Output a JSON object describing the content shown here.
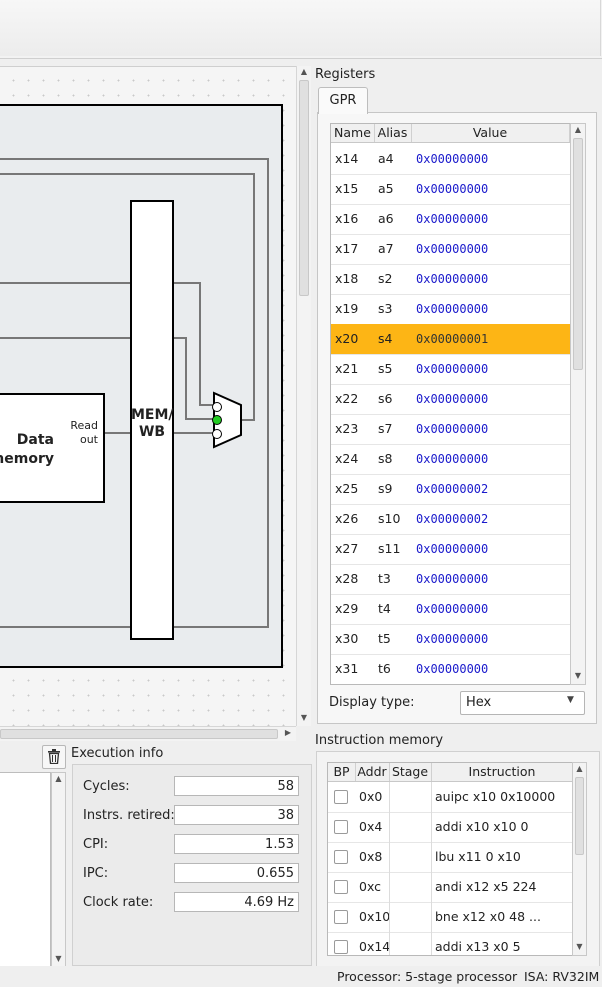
{
  "registers_panel": {
    "title": "Registers",
    "tab": "GPR",
    "columns": [
      "Name",
      "Alias",
      "Value"
    ],
    "rows": [
      {
        "name": "x14",
        "alias": "a4",
        "value": "0x00000000"
      },
      {
        "name": "x15",
        "alias": "a5",
        "value": "0x00000000"
      },
      {
        "name": "x16",
        "alias": "a6",
        "value": "0x00000000"
      },
      {
        "name": "x17",
        "alias": "a7",
        "value": "0x00000000"
      },
      {
        "name": "x18",
        "alias": "s2",
        "value": "0x00000000"
      },
      {
        "name": "x19",
        "alias": "s3",
        "value": "0x00000000"
      },
      {
        "name": "x20",
        "alias": "s4",
        "value": "0x00000001",
        "selected": true
      },
      {
        "name": "x21",
        "alias": "s5",
        "value": "0x00000000"
      },
      {
        "name": "x22",
        "alias": "s6",
        "value": "0x00000000"
      },
      {
        "name": "x23",
        "alias": "s7",
        "value": "0x00000000"
      },
      {
        "name": "x24",
        "alias": "s8",
        "value": "0x00000000"
      },
      {
        "name": "x25",
        "alias": "s9",
        "value": "0x00000002"
      },
      {
        "name": "x26",
        "alias": "s10",
        "value": "0x00000002"
      },
      {
        "name": "x27",
        "alias": "s11",
        "value": "0x00000000"
      },
      {
        "name": "x28",
        "alias": "t3",
        "value": "0x00000000"
      },
      {
        "name": "x29",
        "alias": "t4",
        "value": "0x00000000"
      },
      {
        "name": "x30",
        "alias": "t5",
        "value": "0x00000000"
      },
      {
        "name": "x31",
        "alias": "t6",
        "value": "0x00000000"
      }
    ],
    "display_type_label": "Display type:",
    "display_type_value": "Hex",
    "highlight_color": "#fdb515",
    "value_color": "#1a1acc"
  },
  "datapath": {
    "data_memory_label_1": "Data",
    "data_memory_label_2": "memory",
    "read_out_label_1": "Read",
    "read_out_label_2": "out",
    "mem_wb_label_1": "MEM/",
    "mem_wb_label_2": "WB",
    "active_port_color": "#22cc22"
  },
  "execution_info": {
    "title": "Execution info",
    "fields": [
      {
        "label": "Cycles:",
        "value": "58"
      },
      {
        "label": "Instrs. retired:",
        "value": "38"
      },
      {
        "label": "CPI:",
        "value": "1.53"
      },
      {
        "label": "IPC:",
        "value": "0.655"
      },
      {
        "label": "Clock rate:",
        "value": "4.69 Hz"
      }
    ]
  },
  "instruction_memory": {
    "title": "Instruction memory",
    "columns": [
      "BP",
      "Addr",
      "Stage",
      "Instruction"
    ],
    "rows": [
      {
        "addr": "0x0",
        "stage": "",
        "instruction": "auipc x10 0x10000"
      },
      {
        "addr": "0x4",
        "stage": "",
        "instruction": "addi x10 x10 0"
      },
      {
        "addr": "0x8",
        "stage": "",
        "instruction": "lbu x11 0 x10"
      },
      {
        "addr": "0xc",
        "stage": "",
        "instruction": "andi x12 x5 224"
      },
      {
        "addr": "0x10",
        "stage": "",
        "instruction": "bne x12 x0 48 ..."
      },
      {
        "addr": "0x14",
        "stage": "",
        "instruction": "addi x13 x0 5"
      }
    ]
  },
  "status_bar": {
    "processor": "Processor: 5-stage processor",
    "isa": "ISA: RV32IM"
  },
  "icons": {
    "trash": "trash-icon",
    "scroll_up": "scroll-up-icon",
    "scroll_down": "scroll-down-icon",
    "scroll_right": "scroll-right-icon",
    "dropdown": "chevron-down-icon"
  }
}
